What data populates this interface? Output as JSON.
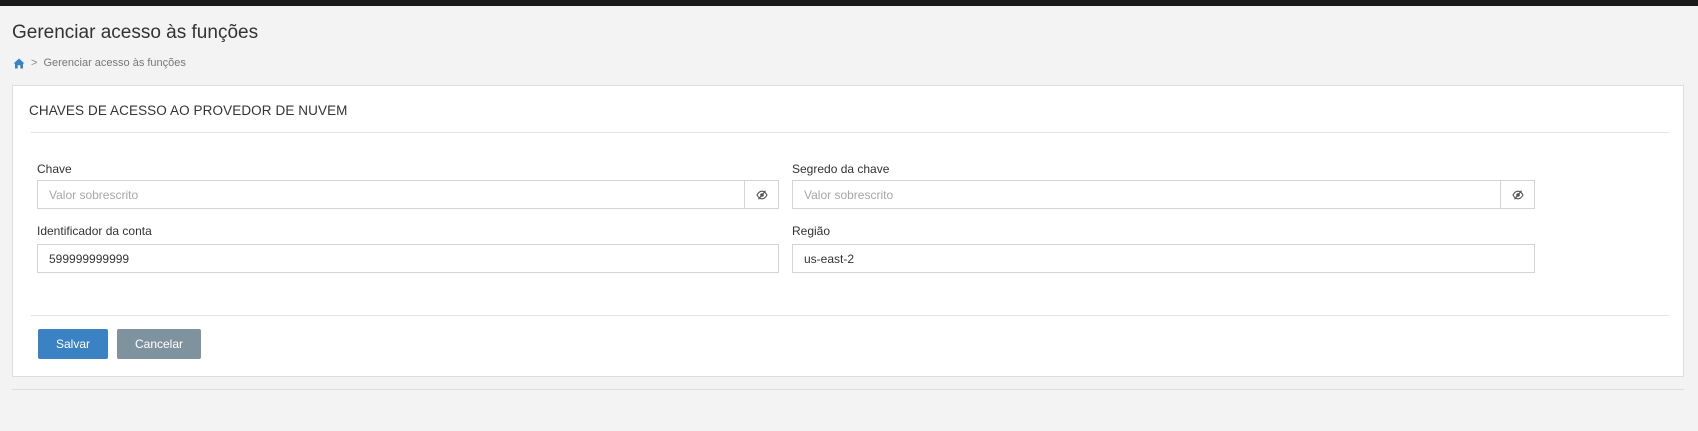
{
  "page": {
    "title": "Gerenciar acesso às funções"
  },
  "breadcrumb": {
    "home_icon": "home-icon",
    "separator": ">",
    "current": "Gerenciar acesso às funções"
  },
  "panel": {
    "title": "CHAVES DE ACESSO AO PROVEDOR DE NUVEM"
  },
  "form": {
    "key": {
      "label": "Chave",
      "placeholder": "Valor sobrescrito",
      "value": "",
      "toggle_icon": "eye-slash-icon"
    },
    "key_secret": {
      "label": "Segredo da chave",
      "placeholder": "Valor sobrescrito",
      "value": "",
      "toggle_icon": "eye-slash-icon"
    },
    "account_id": {
      "label": "Identificador da conta",
      "value": "599999999999"
    },
    "region": {
      "label": "Região",
      "value": "us-east-2"
    }
  },
  "actions": {
    "save_label": "Salvar",
    "cancel_label": "Cancelar"
  },
  "colors": {
    "primary": "#3b82c4",
    "secondary": "#7f939f",
    "breadcrumb_icon": "#3b82c4"
  }
}
